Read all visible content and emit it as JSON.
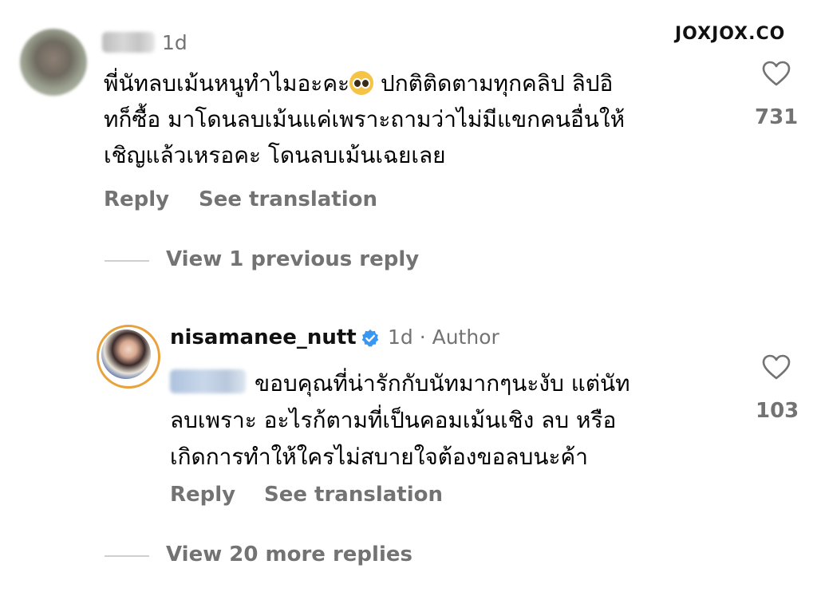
{
  "watermark": "JOXJOX.CO",
  "comment": {
    "time": "1d",
    "text": "พี่นัทลบเม้นหนูทำไมอะคะ",
    "text_rest": " ปกติติดตามทุกคลิป ลิปอิ\nทก็ซื้อ มาโดนลบเม้นแค่เพราะถามว่าไม่มีแขกคนอื่นให้\nเชิญแล้วเหรอคะ โดนลบเม้นเฉยเลย",
    "emoji": "pleading-face-emoji",
    "reply_label": "Reply",
    "translation_label": "See translation",
    "likes": "731",
    "view_previous": "View 1 previous reply"
  },
  "reply": {
    "username": "nisamanee_nutt",
    "time_author": "1d · Author",
    "text": "ขอบคุณที่น่ารักกับนัทมากๆนะงับ แต่นัท\nลบเพราะ อะไรก้ตามที่เป็นคอมเม้นเชิง ลบ หรือ\nเกิดการทำให้ใครไม่สบายใจต้องขอลบนะค้า",
    "reply_label": "Reply",
    "translation_label": "See translation",
    "likes": "103",
    "view_more": "View 20 more replies"
  },
  "colors": {
    "secondary_text": "#737373",
    "verified_blue": "#3897f0",
    "story_ring": "#e9a23b"
  }
}
